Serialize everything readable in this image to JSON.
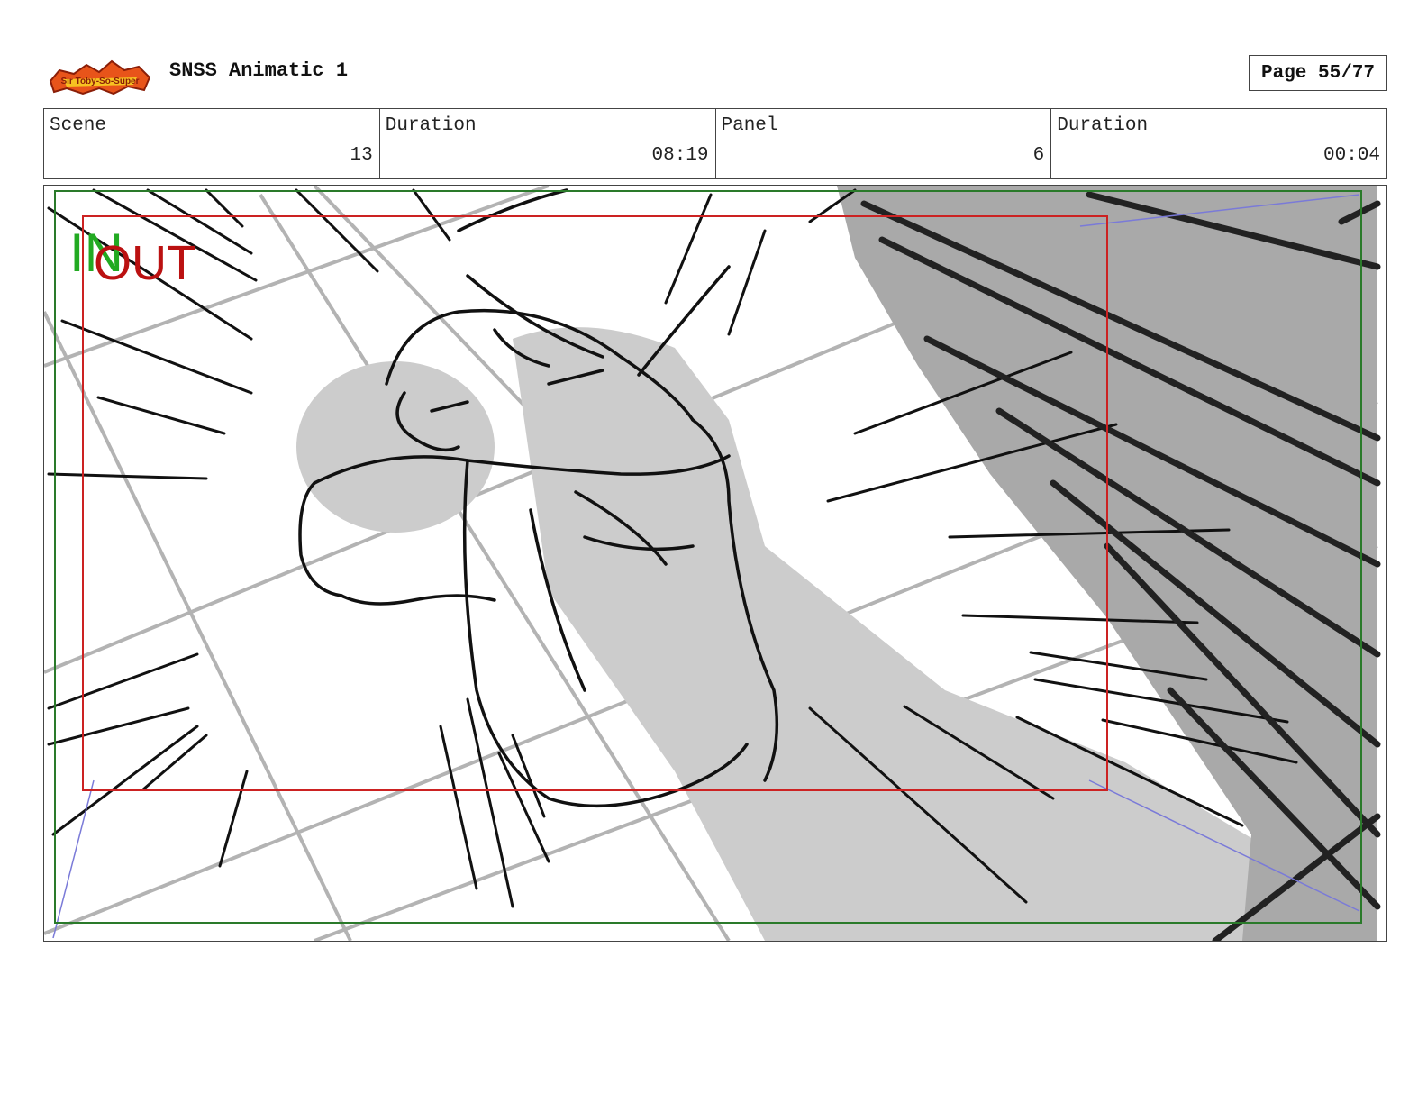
{
  "header": {
    "logo_text": "Sir Toby-So-Super",
    "project_title": "SNSS Animatic 1",
    "page_label": "Page 55/77"
  },
  "info": {
    "scene_label": "Scene",
    "scene_value": "13",
    "scene_duration_label": "Duration",
    "scene_duration_value": "08:19",
    "panel_label": "Panel",
    "panel_value": "6",
    "panel_duration_label": "Duration",
    "panel_duration_value": "00:04"
  },
  "frame": {
    "in_label": "IN",
    "out_label": "OUT",
    "colors": {
      "in": "#22aa22",
      "out": "#bb1111",
      "safe_frame": "#cc2222",
      "outer_frame": "#2a7a2a",
      "shadow": "#cccccc",
      "dark_shadow": "#a9a9a9"
    }
  }
}
